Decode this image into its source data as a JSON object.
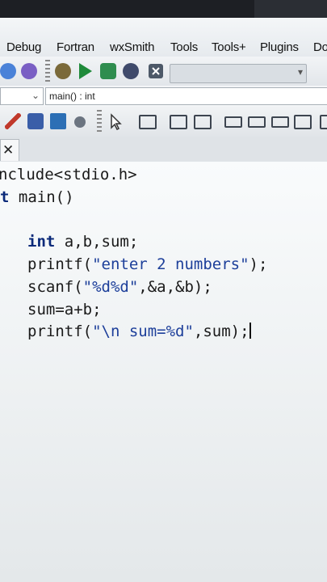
{
  "menu": [
    "Debug",
    "Fortran",
    "wxSmith",
    "Tools",
    "Tools+",
    "Plugins",
    "Do"
  ],
  "scope_value": "main() : int",
  "code": {
    "line1": "nclude<stdio.h>",
    "line2_kw": "t",
    "line2_rest": " main()",
    "line3_kw": "int",
    "line3_rest": " a,b,sum;",
    "line4_a": "printf(",
    "line4_str": "\"enter 2 numbers\"",
    "line4_b": ");",
    "line5_a": "scanf(",
    "line5_str": "\"%d%d\"",
    "line5_b": ",&a,&b);",
    "line6": "sum=a+b;",
    "line7_a": "printf(",
    "line7_str": "\"\\n sum=%d\"",
    "line7_b": ",sum);"
  },
  "colors": {
    "editor_bg": "#f9fbfc",
    "keyword": "#0b2a7a"
  }
}
